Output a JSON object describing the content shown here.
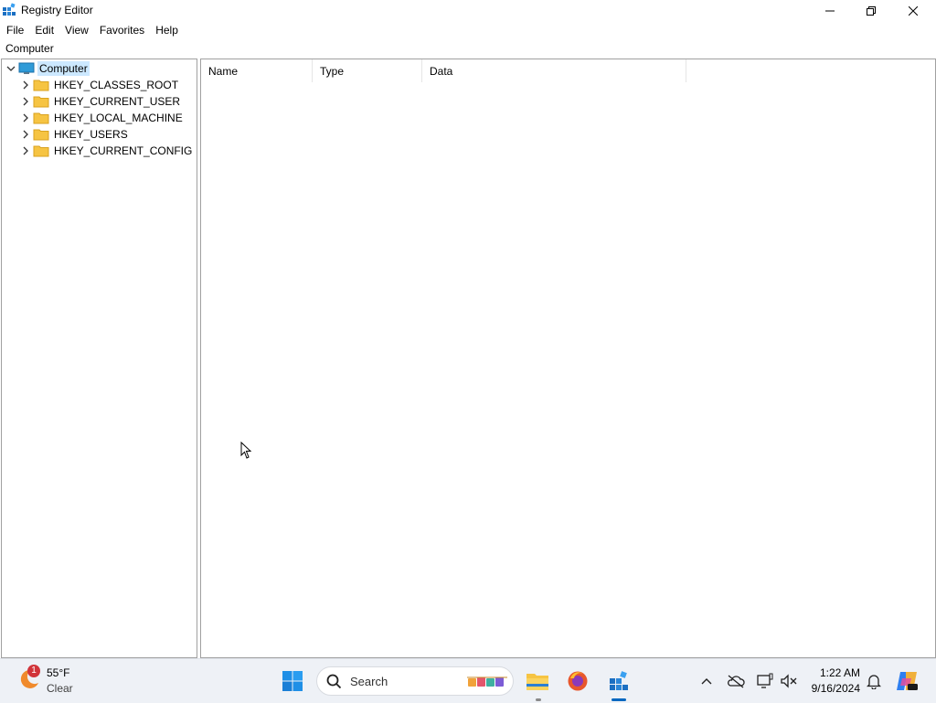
{
  "window": {
    "title": "Registry Editor",
    "icon": "registry-editor-icon",
    "controls": [
      "minimize-icon",
      "restore-icon",
      "close-icon"
    ]
  },
  "menu": {
    "items": [
      "File",
      "Edit",
      "View",
      "Favorites",
      "Help"
    ]
  },
  "address": {
    "path": "Computer"
  },
  "tree": {
    "root": {
      "label": "Computer",
      "icon": "computer-icon",
      "expanded": true,
      "selected": true
    },
    "items": [
      {
        "label": "HKEY_CLASSES_ROOT",
        "icon": "folder-icon"
      },
      {
        "label": "HKEY_CURRENT_USER",
        "icon": "folder-icon"
      },
      {
        "label": "HKEY_LOCAL_MACHINE",
        "icon": "folder-icon"
      },
      {
        "label": "HKEY_USERS",
        "icon": "folder-icon"
      },
      {
        "label": "HKEY_CURRENT_CONFIG",
        "icon": "folder-icon"
      }
    ]
  },
  "list": {
    "columns": [
      "Name",
      "Type",
      "Data"
    ],
    "rows": []
  },
  "taskbar": {
    "weather": {
      "temp": "55°F",
      "condition": "Clear",
      "badge": "1"
    },
    "search_placeholder": "Search",
    "apps": [
      "start-icon",
      "file-explorer-icon",
      "firefox-icon",
      "registry-editor-icon"
    ],
    "tray": [
      "chevron-up-icon",
      "onedrive-icon",
      "network-icon",
      "speaker-icon",
      "bell-icon",
      "copilot-icon"
    ],
    "clock": {
      "time": "1:22 AM",
      "date": "9/16/2024"
    }
  },
  "colors": {
    "selection": "#cce8ff",
    "folder": "#f6c443",
    "accent": "#0067c0"
  }
}
